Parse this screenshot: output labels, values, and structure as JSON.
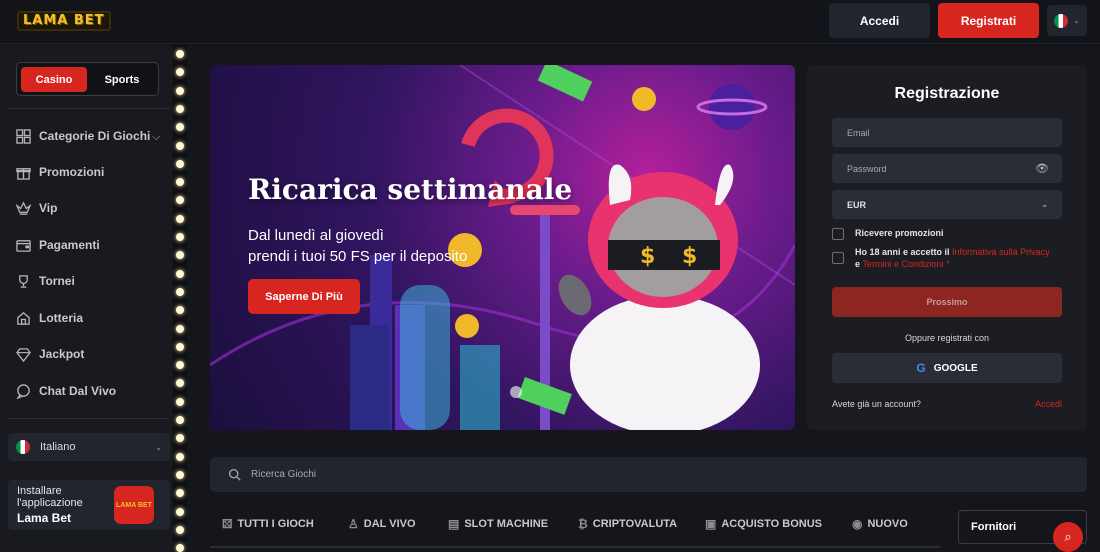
{
  "header": {
    "logo": "LAMA BET",
    "login_label": "Accedi",
    "register_label": "Registrati",
    "language_flag": "italy-flag-icon"
  },
  "sidebar": {
    "toggle": {
      "casino": "Casino",
      "sports": "Sports",
      "active": "Casino"
    },
    "items": [
      {
        "label": "Categorie Di Giochi",
        "icon": "categories-icon",
        "expandable": true
      },
      {
        "label": "Promozioni",
        "icon": "gift-icon"
      },
      {
        "label": "Vip",
        "icon": "crown-icon"
      },
      {
        "label": "Pagamenti",
        "icon": "wallet-icon"
      },
      {
        "label": "Tornei",
        "icon": "trophy-icon"
      },
      {
        "label": "Lotteria",
        "icon": "lottery-icon"
      },
      {
        "label": "Jackpot",
        "icon": "diamond-icon"
      },
      {
        "label": "Chat Dal Vivo",
        "icon": "chat-icon"
      }
    ],
    "language": "Italiano",
    "install": {
      "line1": "Installare",
      "line2": "l'applicazione",
      "app_name": "Lama Bet",
      "icon_text": "LAMA BET"
    }
  },
  "banner": {
    "title": "Ricarica settimanale",
    "subtitle_line1": "Dal lunedì al giovedì",
    "subtitle_line2": "prendi i tuoi 50 FS per il deposito",
    "button": "Saperne Di Più"
  },
  "registration": {
    "title": "Registrazione",
    "email_placeholder": "Email",
    "password_placeholder": "Password",
    "currency": "EUR",
    "promo_label": "Ricevere promozioni",
    "terms_prefix": "Ho 18 anni e accetto il",
    "terms_link1": "Informativa sulla Privacy",
    "terms_and": "e",
    "terms_link2": "Termini e Condizioni",
    "terms_required": "*",
    "next_button": "Prossimo",
    "or_register_with": "Oppure registrati con",
    "google_button": "GOOGLE",
    "have_account": "Avete già un account?",
    "login_link": "Accedi"
  },
  "search": {
    "placeholder": "Ricerca Giochi"
  },
  "game_tabs": [
    {
      "label": "TUTTI I GIOCH",
      "icon": "dice-icon"
    },
    {
      "label": "DAL VIVO",
      "icon": "dealer-icon"
    },
    {
      "label": "SLOT MACHINE",
      "icon": "slot-icon"
    },
    {
      "label": "CRIPTOVALUTA",
      "icon": "bitcoin-icon"
    },
    {
      "label": "ACQUISTO BONUS",
      "icon": "bonus-icon"
    },
    {
      "label": "NUOVO",
      "icon": "new-icon"
    }
  ],
  "providers_label": "Fornitori",
  "colors": {
    "accent": "#d7251f",
    "background": "#14161b",
    "panel": "#1b1d23"
  }
}
